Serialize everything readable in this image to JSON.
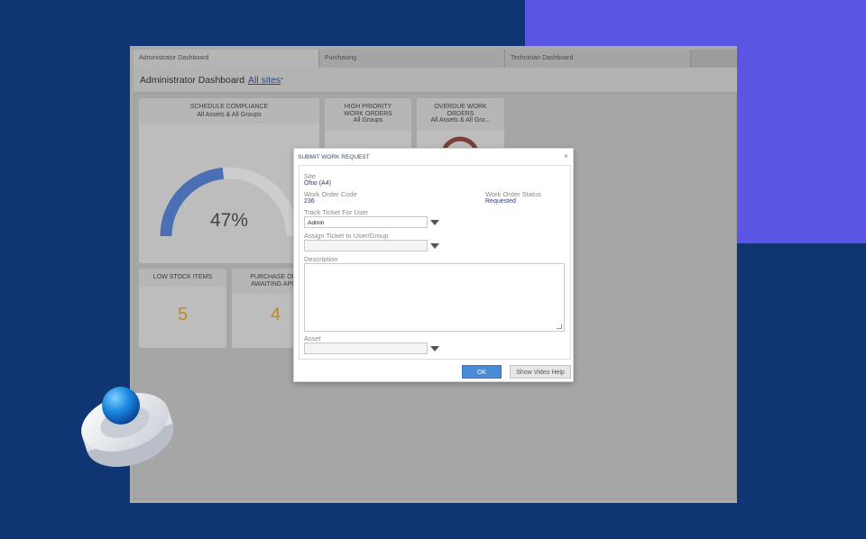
{
  "tabs": [
    "Administrator Dashboard",
    "Purchasing",
    "Technician Dashboard"
  ],
  "header": {
    "title": "Administrator Dashboard",
    "sites_link": "All sites",
    "sep": "-",
    "sep2": "-"
  },
  "cards": {
    "schedule": {
      "title": "SCHEDULE COMPLIANCE",
      "subtitle": "All Assets & All Groups",
      "percent_label": "47%",
      "percent": 0.47
    },
    "high_priority": {
      "title1": "HIGH PRIORITY",
      "title2": "WORK ORDERS",
      "subtitle": "All Groups"
    },
    "overdue": {
      "title1": "OVERDUE WORK",
      "title2": "ORDERS",
      "subtitle": "All Assets & All Gro..."
    },
    "low_stock": {
      "title": "LOW STOCK ITEMS",
      "value": "5"
    },
    "purchase": {
      "title1": "PURCHASE ORD",
      "title2": "AWAITING APPR",
      "value": "4"
    }
  },
  "dialog": {
    "title": "SUBMIT WORK REQUEST",
    "close": "×",
    "site_label": "Site",
    "site_value": "Ohio (A4)",
    "code_label": "Work Order Code",
    "code_value": "236",
    "status_label": "Work Order Status",
    "status_value": "Requested",
    "track_label": "Track Ticket For User",
    "track_value": "Admin",
    "assign_label": "Assign Ticket to User/Group",
    "assign_value": "",
    "description_label": "Description",
    "asset_label": "Asset",
    "asset_value": "",
    "ok": "OK",
    "help": "Show Video Help"
  },
  "colors": {
    "background": "#0f3672",
    "accent": "#5a55e3",
    "gauge": "#4a6fb5",
    "number": "#c08a1c",
    "ok_button": "#4b8ad6"
  }
}
